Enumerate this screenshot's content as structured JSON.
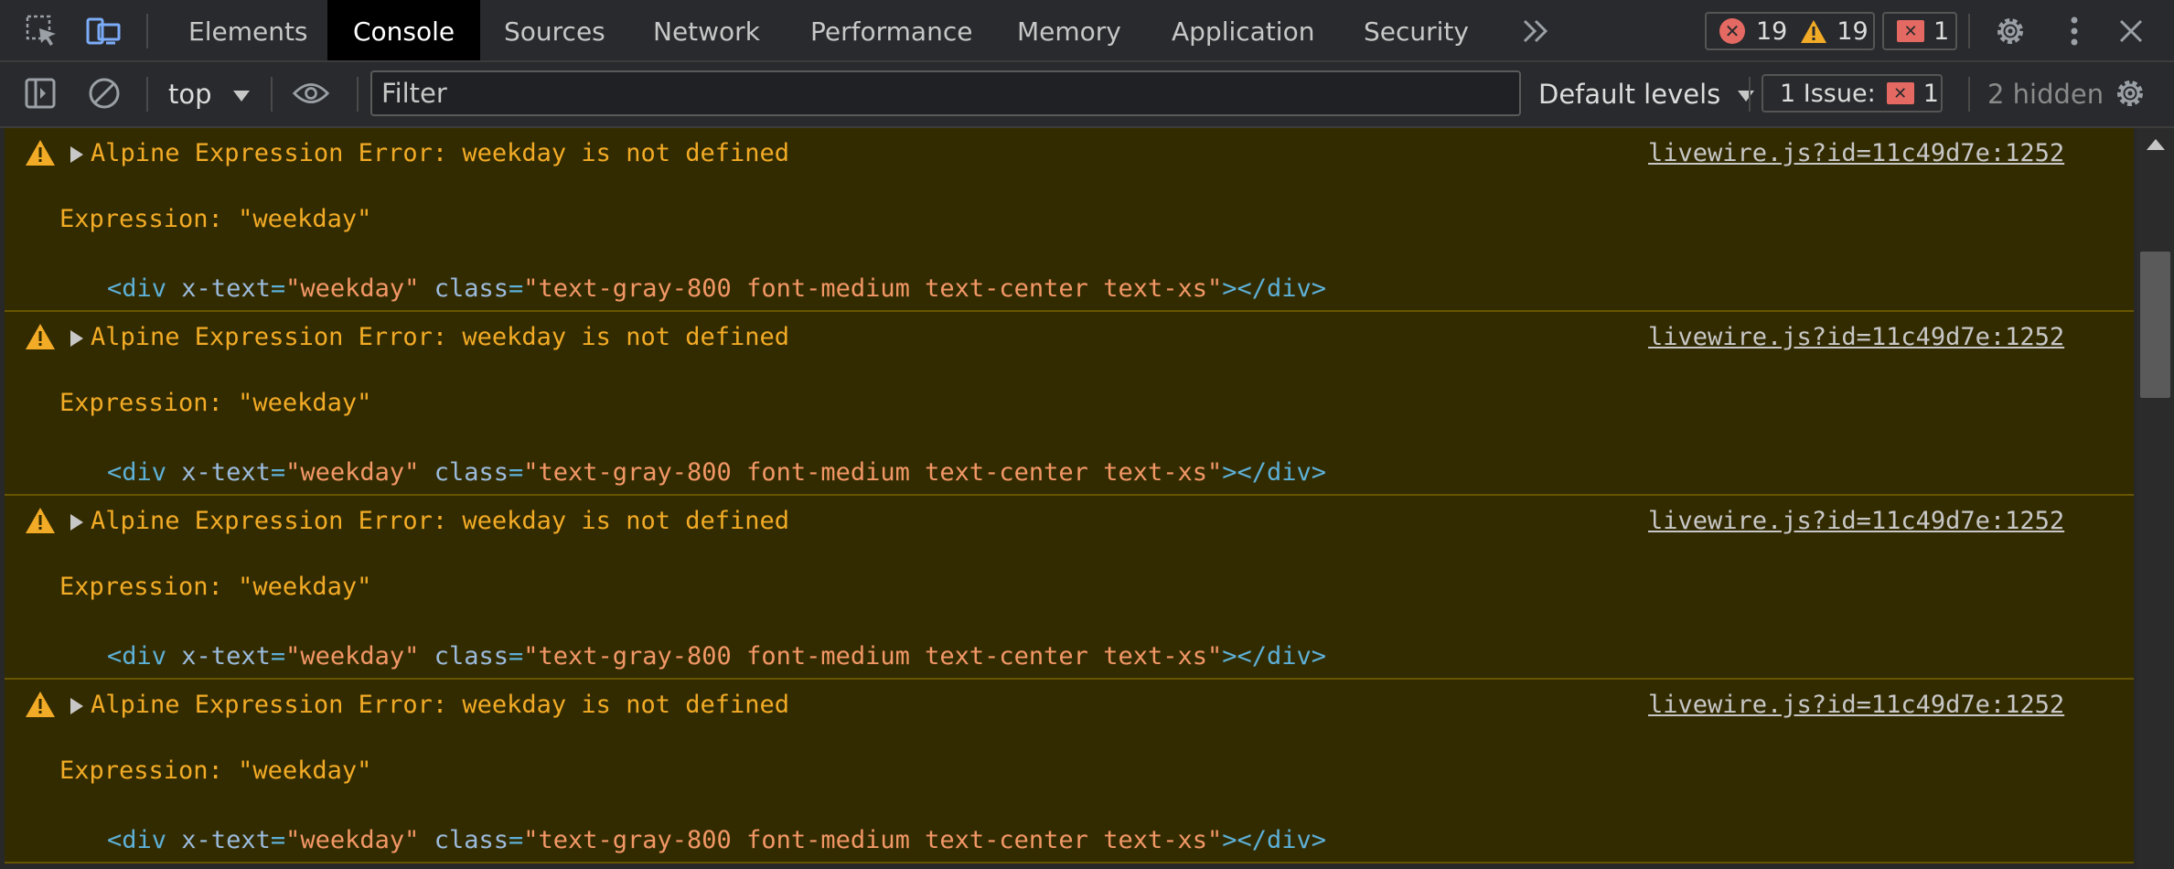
{
  "tabbar": {
    "tabs": [
      {
        "label": "Elements"
      },
      {
        "label": "Console"
      },
      {
        "label": "Sources"
      },
      {
        "label": "Network"
      },
      {
        "label": "Performance"
      },
      {
        "label": "Memory"
      },
      {
        "label": "Application"
      },
      {
        "label": "Security"
      }
    ],
    "active_tab": "Console",
    "more_tabs_icon": "chevron-double-right-icon",
    "counters": {
      "errors": "19",
      "warnings": "19",
      "issues": "1"
    },
    "icons": [
      "inspect-element-icon",
      "device-toolbar-icon",
      "gear-icon",
      "kebab-menu-icon",
      "close-icon"
    ]
  },
  "toolbar": {
    "context": "top",
    "filter_placeholder": "Filter",
    "levels": "Default levels",
    "issues_label": "1 Issue:",
    "issues_count": "1",
    "hidden": "2 hidden",
    "icons": [
      "sidebar-toggle-icon",
      "clear-console-icon",
      "eye-icon",
      "gear-icon"
    ]
  },
  "messages": [
    {
      "text": "Alpine Expression Error: weekday is not defined",
      "expression": "Expression: \"weekday\"",
      "code": {
        "open": "<div",
        "attr1": "x-text",
        "val1": "\"weekday\"",
        "attr2": "class",
        "val2": "\"text-gray-800 font-medium text-center text-xs\"",
        "close": "></div>"
      },
      "source": "livewire.js?id=11c49d7e:1252"
    },
    {
      "text": "Alpine Expression Error: weekday is not defined",
      "expression": "Expression: \"weekday\"",
      "code": {
        "open": "<div",
        "attr1": "x-text",
        "val1": "\"weekday\"",
        "attr2": "class",
        "val2": "\"text-gray-800 font-medium text-center text-xs\"",
        "close": "></div>"
      },
      "source": "livewire.js?id=11c49d7e:1252"
    },
    {
      "text": "Alpine Expression Error: weekday is not defined",
      "expression": "Expression: \"weekday\"",
      "code": {
        "open": "<div",
        "attr1": "x-text",
        "val1": "\"weekday\"",
        "attr2": "class",
        "val2": "\"text-gray-800 font-medium text-center text-xs\"",
        "close": "></div>"
      },
      "source": "livewire.js?id=11c49d7e:1252"
    },
    {
      "text": "Alpine Expression Error: weekday is not defined",
      "expression": "Expression: \"weekday\"",
      "code": {
        "open": "<div",
        "attr1": "x-text",
        "val1": "\"weekday\"",
        "attr2": "class",
        "val2": "\"text-gray-800 font-medium text-center text-xs\"",
        "close": "></div>"
      },
      "source": "livewire.js?id=11c49d7e:1252"
    }
  ],
  "colors": {
    "warning_bg": "#332b00",
    "warning_text": "#f2ab26",
    "error_red": "#e46962",
    "warning_orange": "#f2ab26"
  }
}
